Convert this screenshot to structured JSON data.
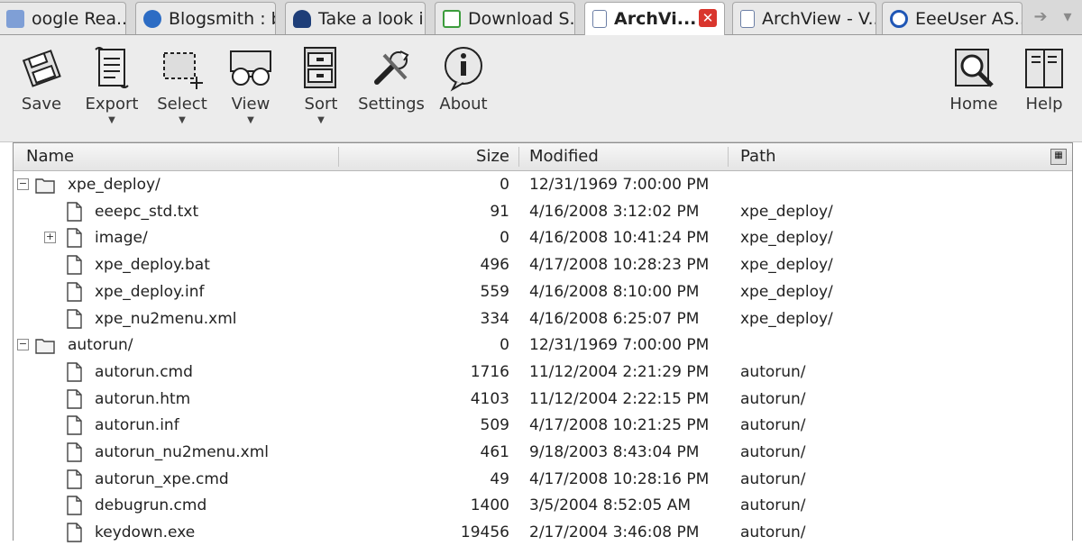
{
  "tabs": [
    {
      "label": "oogle Rea...",
      "icon": "google-reader-icon",
      "color": "#6f8fc9"
    },
    {
      "label": "Blogsmith : b...",
      "icon": "blogsmith-icon",
      "color": "#2c6cc4"
    },
    {
      "label": "Take a look i...",
      "icon": "eye-icon",
      "color": "#1e3e78"
    },
    {
      "label": "Download S...",
      "icon": "download-icon",
      "color": "#3c9c3c"
    },
    {
      "label": "ArchVi...",
      "icon": "page-icon",
      "color": "#ffffff"
    },
    {
      "label": "ArchView - V...",
      "icon": "page-icon",
      "color": "#ffffff"
    },
    {
      "label": "EeeUser AS...",
      "icon": "eeeuser-icon",
      "color": "#1f56b5"
    }
  ],
  "toolbar": {
    "save": "Save",
    "export": "Export",
    "select": "Select",
    "view": "View",
    "sort": "Sort",
    "settings": "Settings",
    "about": "About",
    "home": "Home",
    "help": "Help"
  },
  "columns": {
    "name": "Name",
    "size": "Size",
    "modified": "Modified",
    "path": "Path"
  },
  "files": [
    {
      "name": "xpe_deploy/",
      "size": "0",
      "modified": "12/31/1969 7:00:00 PM",
      "path": "",
      "type": "folder",
      "level": 0,
      "expander": "−"
    },
    {
      "name": "eeepc_std.txt",
      "size": "91",
      "modified": "4/16/2008 3:12:02 PM",
      "path": "xpe_deploy/",
      "type": "file",
      "level": 1,
      "expander": ""
    },
    {
      "name": "image/",
      "size": "0",
      "modified": "4/16/2008 10:41:24 PM",
      "path": "xpe_deploy/",
      "type": "file",
      "level": 1,
      "expander": "+"
    },
    {
      "name": "xpe_deploy.bat",
      "size": "496",
      "modified": "4/17/2008 10:28:23 PM",
      "path": "xpe_deploy/",
      "type": "file",
      "level": 1,
      "expander": ""
    },
    {
      "name": "xpe_deploy.inf",
      "size": "559",
      "modified": "4/16/2008 8:10:00 PM",
      "path": "xpe_deploy/",
      "type": "file",
      "level": 1,
      "expander": ""
    },
    {
      "name": "xpe_nu2menu.xml",
      "size": "334",
      "modified": "4/16/2008 6:25:07 PM",
      "path": "xpe_deploy/",
      "type": "file",
      "level": 1,
      "expander": ""
    },
    {
      "name": "autorun/",
      "size": "0",
      "modified": "12/31/1969 7:00:00 PM",
      "path": "",
      "type": "folder",
      "level": 0,
      "expander": "−"
    },
    {
      "name": "autorun.cmd",
      "size": "1716",
      "modified": "11/12/2004 2:21:29 PM",
      "path": "autorun/",
      "type": "file",
      "level": 1,
      "expander": ""
    },
    {
      "name": "autorun.htm",
      "size": "4103",
      "modified": "11/12/2004 2:22:15 PM",
      "path": "autorun/",
      "type": "file",
      "level": 1,
      "expander": ""
    },
    {
      "name": "autorun.inf",
      "size": "509",
      "modified": "4/17/2008 10:21:25 PM",
      "path": "autorun/",
      "type": "file",
      "level": 1,
      "expander": ""
    },
    {
      "name": "autorun_nu2menu.xml",
      "size": "461",
      "modified": "9/18/2003 8:43:04 PM",
      "path": "autorun/",
      "type": "file",
      "level": 1,
      "expander": ""
    },
    {
      "name": "autorun_xpe.cmd",
      "size": "49",
      "modified": "4/17/2008 10:28:16 PM",
      "path": "autorun/",
      "type": "file",
      "level": 1,
      "expander": ""
    },
    {
      "name": "debugrun.cmd",
      "size": "1400",
      "modified": "3/5/2004 8:52:05 AM",
      "path": "autorun/",
      "type": "file",
      "level": 1,
      "expander": ""
    },
    {
      "name": "keydown.exe",
      "size": "19456",
      "modified": "2/17/2004 3:46:08 PM",
      "path": "autorun/",
      "type": "file",
      "level": 1,
      "expander": ""
    }
  ]
}
